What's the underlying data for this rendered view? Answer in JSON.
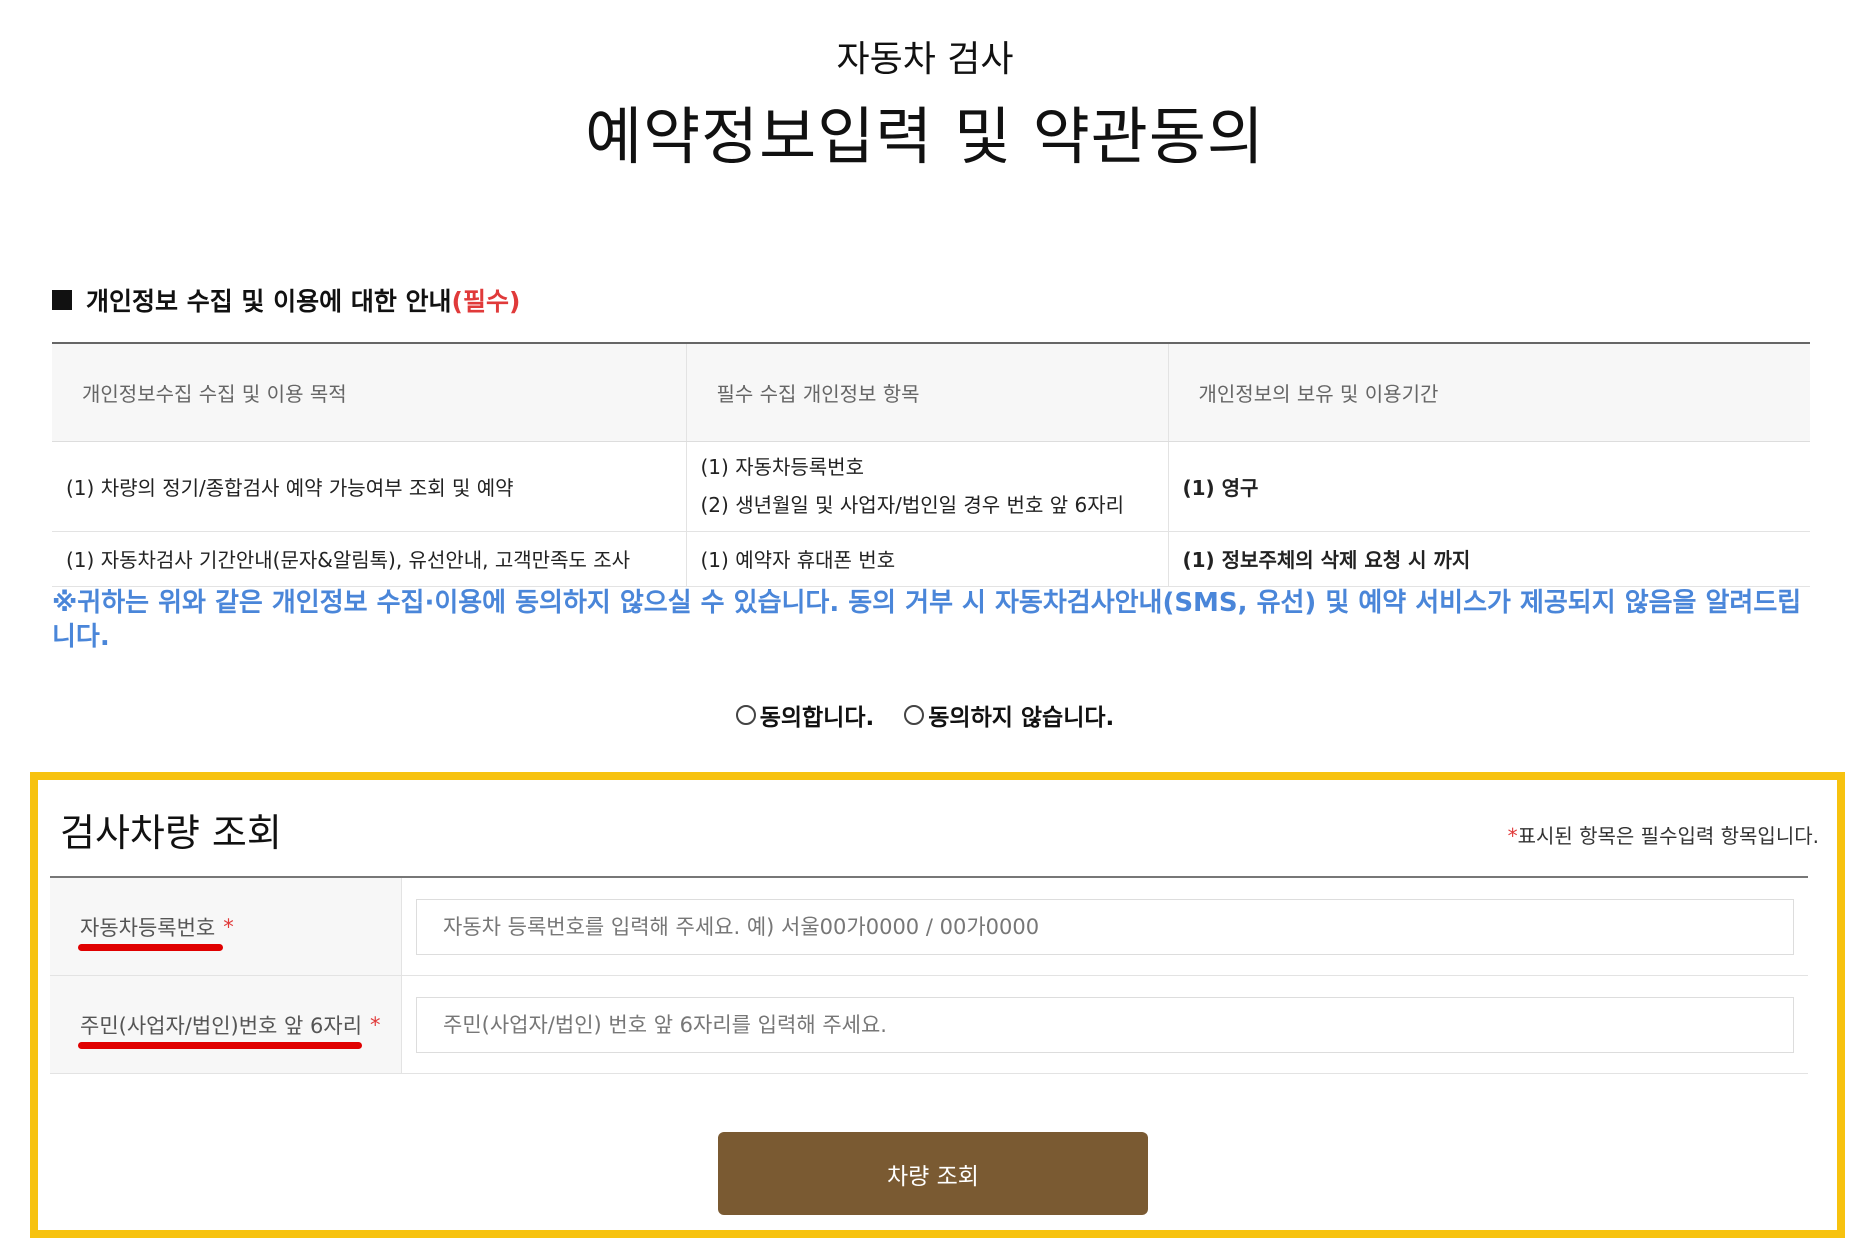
{
  "header": {
    "subtitle": "자동차 검사",
    "title": "예약정보입력 및 약관동의"
  },
  "privacy": {
    "heading": "개인정보 수집 및 이용에 대한 안내",
    "required_label": "(필수)",
    "columns": [
      "개인정보수집 수집 및 이용 목적",
      "필수 수집 개인정보 항목",
      "개인정보의 보유 및 이용기간"
    ],
    "rows": [
      {
        "purpose": "(1) 차량의 정기/종합검사 예약 가능여부 조회 및 예약",
        "items": [
          "(1) 자동차등록번호",
          "(2) 생년월일 및 사업자/법인일 경우 번호 앞 6자리"
        ],
        "period": "(1) 영구"
      },
      {
        "purpose": "(1) 자동차검사 기간안내(문자&알림톡), 유선안내, 고객만족도 조사",
        "items": [
          "(1) 예약자 휴대폰 번호"
        ],
        "period": "(1) 정보주체의 삭제 요청 시 까지"
      }
    ],
    "notice": "※귀하는 위와 같은 개인정보 수집·이용에 동의하지 않으실 수 있습니다. 동의 거부 시 자동차검사안내(SMS, 유선) 및 예약 서비스가 제공되지 않음을 알려드립니다."
  },
  "consent": {
    "agree_label": "동의합니다.",
    "disagree_label": "동의하지 않습니다."
  },
  "vehicle_lookup": {
    "title": "검사차량 조회",
    "required_star": "*",
    "required_note": "표시된 항목은 필수입력 항목입니다.",
    "fields": {
      "plate_label": "자동차등록번호",
      "plate_placeholder": "자동차 등록번호를 입력해 주세요. 예) 서울00가0000 / 00가0000",
      "id_label": "주민(사업자/법인)번호 앞 6자리",
      "id_placeholder": "주민(사업자/법인) 번호 앞 6자리를 입력해 주세요."
    },
    "button_label": "차량 조회"
  },
  "colors": {
    "highlight_border": "#f7c20f",
    "button_bg": "#7a5a32",
    "accent_blue": "#4a86d9",
    "required_red": "#e03a3a",
    "annotation_red": "#e00000"
  }
}
